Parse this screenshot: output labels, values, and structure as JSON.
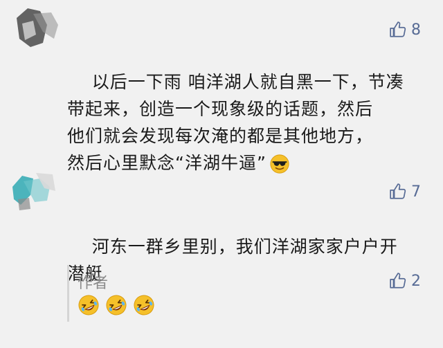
{
  "comments": [
    {
      "likes": "8",
      "text": "以后一下雨 咱洋湖人就自黑一下，节凑\n带起来，创造一个现象级的话题，然后\n他们就会发现每次淹的都是其他地方，\n然后心里默念“洋湖牛逼”",
      "trailing_emoji": "cool-sunglasses-emoji"
    },
    {
      "likes": "7",
      "text": "河东一群乡里别，我们洋湖家家户户开\n潜艇",
      "reply": {
        "author": "作者",
        "likes": "2",
        "emojis": [
          "rofl-emoji",
          "rofl-emoji",
          "rofl-emoji"
        ]
      }
    }
  ],
  "colors": {
    "background": "#f1f1f1",
    "link_blue": "#576b95",
    "text": "#1a1a1a",
    "muted": "#8a8a8a"
  }
}
